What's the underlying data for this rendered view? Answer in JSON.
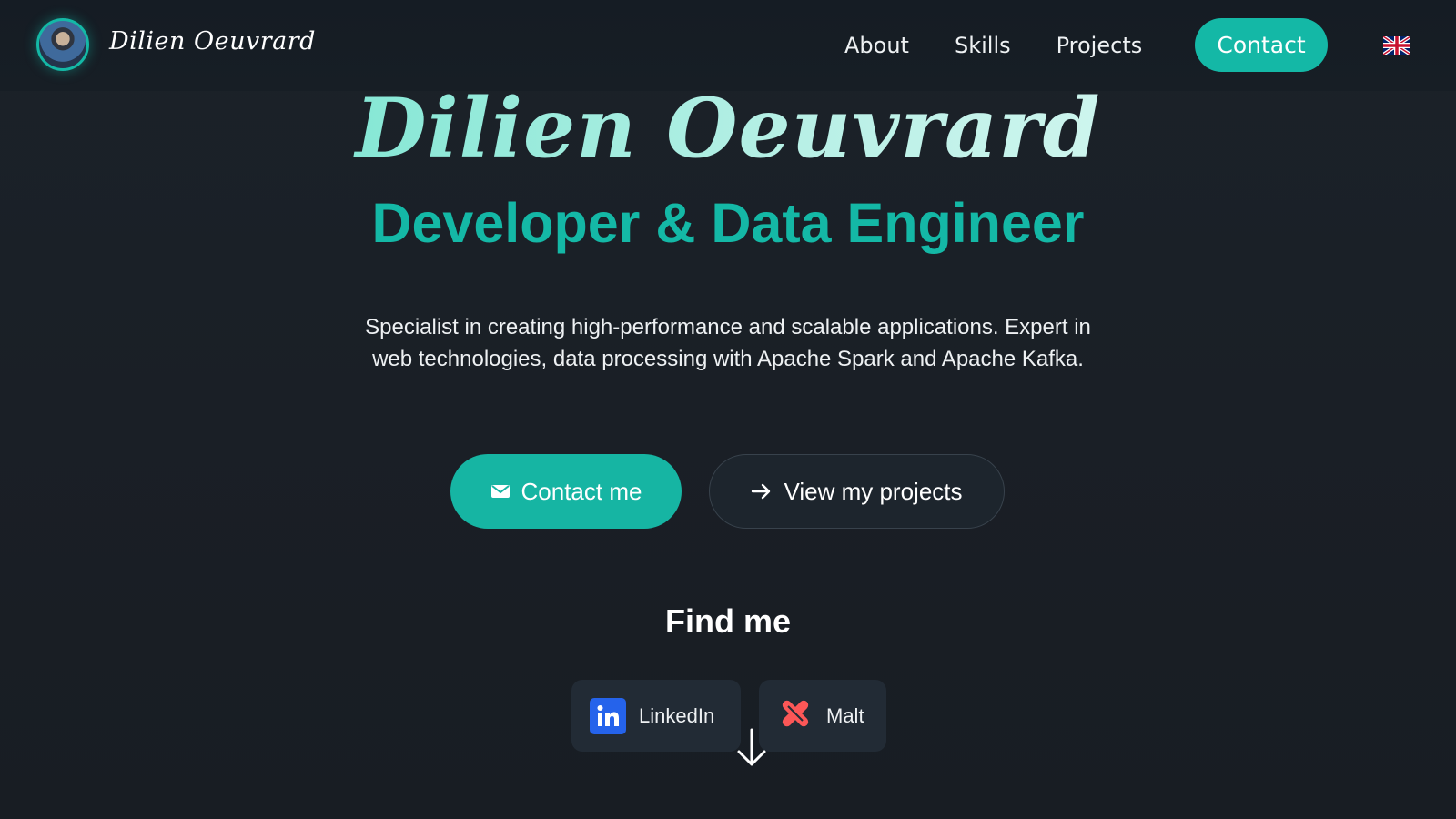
{
  "nav": {
    "brand": "Dilien Oeuvrard",
    "links": [
      "About",
      "Skills",
      "Projects"
    ],
    "contact": "Contact",
    "language_icon": "uk-flag-icon"
  },
  "hero": {
    "name": "Dilien Oeuvrard",
    "role": "Developer & Data Engineer",
    "description": "Specialist in creating high-performance and scalable applications. Expert in web technologies, data processing with Apache Spark and Apache Kafka.",
    "primary_button": "Contact me",
    "secondary_button": "View my projects"
  },
  "social": {
    "title": "Find me",
    "items": [
      {
        "label": "LinkedIn",
        "icon": "linkedin-icon"
      },
      {
        "label": "Malt",
        "icon": "malt-icon"
      }
    ]
  },
  "colors": {
    "accent": "#14b8a6",
    "background": "#1a1f26",
    "linkedin": "#2563eb",
    "malt": "#fc5757"
  }
}
